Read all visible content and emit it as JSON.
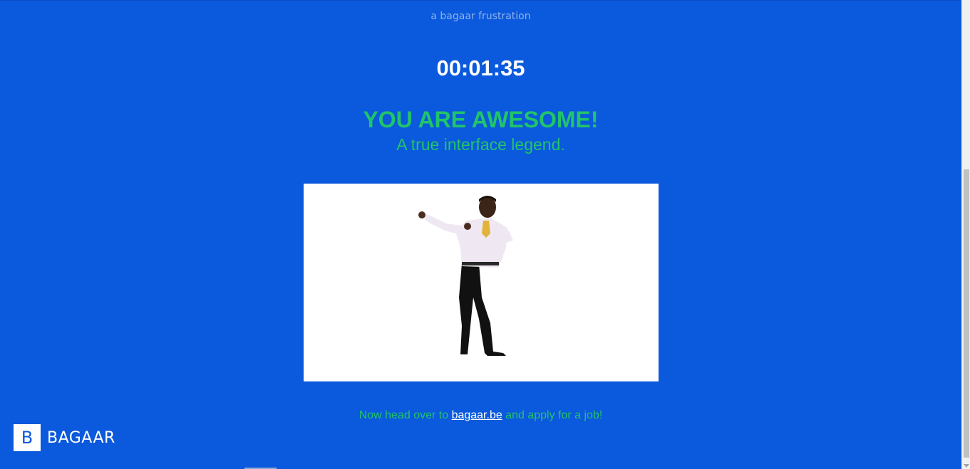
{
  "header": {
    "subtitle": "a bagaar frustration"
  },
  "timer": {
    "value": "00:01:35"
  },
  "result": {
    "headline": "YOU ARE AWESOME!",
    "tagline": "A true interface legend."
  },
  "cta": {
    "before": "Now head over to ",
    "link_text": "bagaar.be",
    "after": " and apply for a job!"
  },
  "logo": {
    "mark": "B",
    "text": "BAGAAR"
  },
  "colors": {
    "background": "#0b59dc",
    "accent_green": "#22c46a",
    "white": "#ffffff"
  },
  "icons": {
    "media": "dancing-man-gif"
  }
}
